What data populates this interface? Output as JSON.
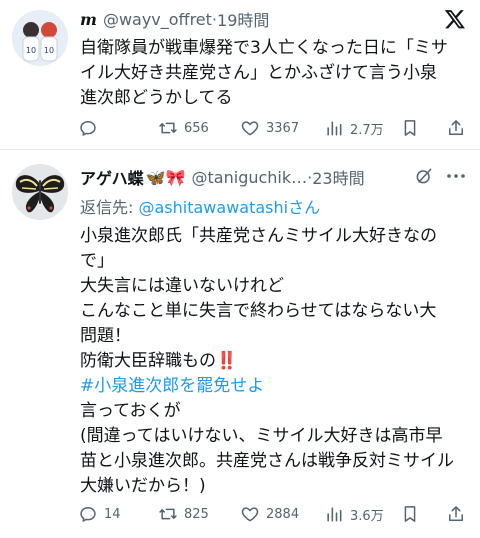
{
  "tweets": [
    {
      "display_name": "m",
      "handle": "@wayv_offret",
      "time": "19時間",
      "text_lines": [
        "自衛隊員が戦車爆発で3人亡くなった日に「ミサ",
        "イル大好き共産党さん」とかふざけて言う小泉",
        "進次郎どうかしてる"
      ],
      "stats": {
        "replies": "",
        "retweets": "656",
        "likes": "3367",
        "views": "2.7万"
      }
    },
    {
      "display_name": "アゲハ蝶",
      "name_emojis": "🦋🎀",
      "handle": "@taniguchik…",
      "time": "23時間",
      "reply_prefix": "返信先:",
      "reply_mention": "@ashitawawatashi",
      "reply_suffix": "さん",
      "text": {
        "l1": "小泉進次郎氏「共産党さんミサイル大好きなの",
        "l2": "で」",
        "l3": "大失言には違いないけれど",
        "l4": "こんなこと単に失言で終わらせてはならない大",
        "l5": "問題！",
        "l6": "防衛大臣辞職もの",
        "l6_mark": "‼️",
        "hashtag": "#小泉進次郎を罷免せよ",
        "l8": "言っておくが",
        "l9": "(間違ってはいけない、ミサイル大好きは高市早",
        "l10": "苗と小泉進次郎。共産党さんは戦争反対ミサイル",
        "l11": "大嫌いだから！)"
      },
      "stats": {
        "replies": "14",
        "retweets": "825",
        "likes": "2884",
        "views": "3.6万"
      }
    }
  ],
  "colors": {
    "text": "#0f1419",
    "muted": "#536471",
    "accent": "#1d9bf0",
    "retweet": "#536471"
  },
  "icons": [
    "x-logo-icon",
    "reply-icon",
    "retweet-icon",
    "like-icon",
    "views-icon",
    "bookmark-icon",
    "share-icon",
    "more-icon",
    "grok-icon"
  ]
}
